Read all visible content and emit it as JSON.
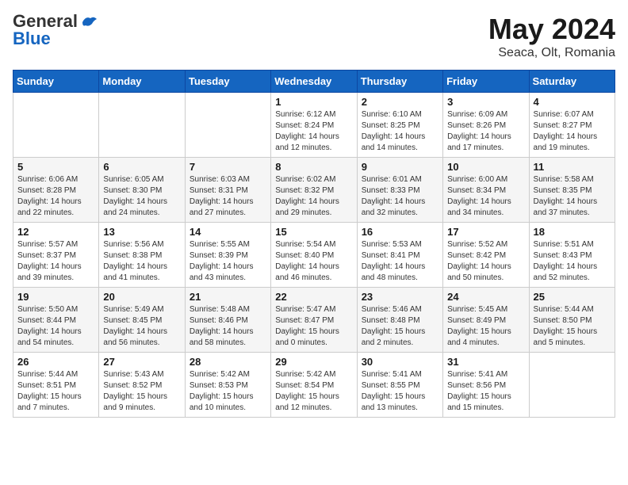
{
  "header": {
    "logo_general": "General",
    "logo_blue": "Blue",
    "title": "May 2024",
    "location": "Seaca, Olt, Romania"
  },
  "days_of_week": [
    "Sunday",
    "Monday",
    "Tuesday",
    "Wednesday",
    "Thursday",
    "Friday",
    "Saturday"
  ],
  "weeks": [
    [
      {
        "day": "",
        "info": ""
      },
      {
        "day": "",
        "info": ""
      },
      {
        "day": "",
        "info": ""
      },
      {
        "day": "1",
        "info": "Sunrise: 6:12 AM\nSunset: 8:24 PM\nDaylight: 14 hours\nand 12 minutes."
      },
      {
        "day": "2",
        "info": "Sunrise: 6:10 AM\nSunset: 8:25 PM\nDaylight: 14 hours\nand 14 minutes."
      },
      {
        "day": "3",
        "info": "Sunrise: 6:09 AM\nSunset: 8:26 PM\nDaylight: 14 hours\nand 17 minutes."
      },
      {
        "day": "4",
        "info": "Sunrise: 6:07 AM\nSunset: 8:27 PM\nDaylight: 14 hours\nand 19 minutes."
      }
    ],
    [
      {
        "day": "5",
        "info": "Sunrise: 6:06 AM\nSunset: 8:28 PM\nDaylight: 14 hours\nand 22 minutes."
      },
      {
        "day": "6",
        "info": "Sunrise: 6:05 AM\nSunset: 8:30 PM\nDaylight: 14 hours\nand 24 minutes."
      },
      {
        "day": "7",
        "info": "Sunrise: 6:03 AM\nSunset: 8:31 PM\nDaylight: 14 hours\nand 27 minutes."
      },
      {
        "day": "8",
        "info": "Sunrise: 6:02 AM\nSunset: 8:32 PM\nDaylight: 14 hours\nand 29 minutes."
      },
      {
        "day": "9",
        "info": "Sunrise: 6:01 AM\nSunset: 8:33 PM\nDaylight: 14 hours\nand 32 minutes."
      },
      {
        "day": "10",
        "info": "Sunrise: 6:00 AM\nSunset: 8:34 PM\nDaylight: 14 hours\nand 34 minutes."
      },
      {
        "day": "11",
        "info": "Sunrise: 5:58 AM\nSunset: 8:35 PM\nDaylight: 14 hours\nand 37 minutes."
      }
    ],
    [
      {
        "day": "12",
        "info": "Sunrise: 5:57 AM\nSunset: 8:37 PM\nDaylight: 14 hours\nand 39 minutes."
      },
      {
        "day": "13",
        "info": "Sunrise: 5:56 AM\nSunset: 8:38 PM\nDaylight: 14 hours\nand 41 minutes."
      },
      {
        "day": "14",
        "info": "Sunrise: 5:55 AM\nSunset: 8:39 PM\nDaylight: 14 hours\nand 43 minutes."
      },
      {
        "day": "15",
        "info": "Sunrise: 5:54 AM\nSunset: 8:40 PM\nDaylight: 14 hours\nand 46 minutes."
      },
      {
        "day": "16",
        "info": "Sunrise: 5:53 AM\nSunset: 8:41 PM\nDaylight: 14 hours\nand 48 minutes."
      },
      {
        "day": "17",
        "info": "Sunrise: 5:52 AM\nSunset: 8:42 PM\nDaylight: 14 hours\nand 50 minutes."
      },
      {
        "day": "18",
        "info": "Sunrise: 5:51 AM\nSunset: 8:43 PM\nDaylight: 14 hours\nand 52 minutes."
      }
    ],
    [
      {
        "day": "19",
        "info": "Sunrise: 5:50 AM\nSunset: 8:44 PM\nDaylight: 14 hours\nand 54 minutes."
      },
      {
        "day": "20",
        "info": "Sunrise: 5:49 AM\nSunset: 8:45 PM\nDaylight: 14 hours\nand 56 minutes."
      },
      {
        "day": "21",
        "info": "Sunrise: 5:48 AM\nSunset: 8:46 PM\nDaylight: 14 hours\nand 58 minutes."
      },
      {
        "day": "22",
        "info": "Sunrise: 5:47 AM\nSunset: 8:47 PM\nDaylight: 15 hours\nand 0 minutes."
      },
      {
        "day": "23",
        "info": "Sunrise: 5:46 AM\nSunset: 8:48 PM\nDaylight: 15 hours\nand 2 minutes."
      },
      {
        "day": "24",
        "info": "Sunrise: 5:45 AM\nSunset: 8:49 PM\nDaylight: 15 hours\nand 4 minutes."
      },
      {
        "day": "25",
        "info": "Sunrise: 5:44 AM\nSunset: 8:50 PM\nDaylight: 15 hours\nand 5 minutes."
      }
    ],
    [
      {
        "day": "26",
        "info": "Sunrise: 5:44 AM\nSunset: 8:51 PM\nDaylight: 15 hours\nand 7 minutes."
      },
      {
        "day": "27",
        "info": "Sunrise: 5:43 AM\nSunset: 8:52 PM\nDaylight: 15 hours\nand 9 minutes."
      },
      {
        "day": "28",
        "info": "Sunrise: 5:42 AM\nSunset: 8:53 PM\nDaylight: 15 hours\nand 10 minutes."
      },
      {
        "day": "29",
        "info": "Sunrise: 5:42 AM\nSunset: 8:54 PM\nDaylight: 15 hours\nand 12 minutes."
      },
      {
        "day": "30",
        "info": "Sunrise: 5:41 AM\nSunset: 8:55 PM\nDaylight: 15 hours\nand 13 minutes."
      },
      {
        "day": "31",
        "info": "Sunrise: 5:41 AM\nSunset: 8:56 PM\nDaylight: 15 hours\nand 15 minutes."
      },
      {
        "day": "",
        "info": ""
      }
    ]
  ]
}
